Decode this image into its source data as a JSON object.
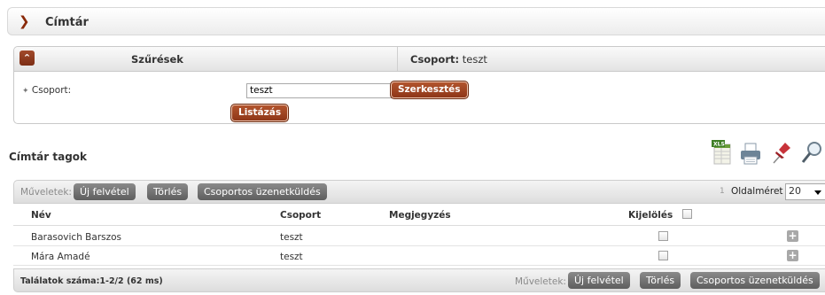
{
  "header": {
    "title": "Címtár"
  },
  "filters": {
    "toggle_label": "Szűrések",
    "group_summary_label": "Csoport:",
    "group_summary_value": "teszt",
    "group_field_label": "Csoport:",
    "group_value": "teszt",
    "edit_button": "Szerkesztés",
    "list_button": "Listázás"
  },
  "section": {
    "title": "Címtár tagok"
  },
  "icons": [
    "excel-export-icon",
    "print-icon",
    "pin-icon",
    "search-icon"
  ],
  "toolbar": {
    "ops_label": "Műveletek:",
    "new_button": "Új felvétel",
    "delete_button": "Törlés",
    "group_message_button": "Csoportos üzenetküldés",
    "page_number": "1",
    "page_size_label": "Oldalméret",
    "page_size_value": "20"
  },
  "table": {
    "columns": {
      "name": "Név",
      "group": "Csoport",
      "note": "Megjegyzés",
      "select": "Kijelölés"
    },
    "rows": [
      {
        "name": "Barasovich Barszos",
        "group": "teszt",
        "note": ""
      },
      {
        "name": "Mára Amadé",
        "group": "teszt",
        "note": ""
      }
    ]
  },
  "footer": {
    "count": "Találatok száma:1-2/2 (62 ms)",
    "ops_label": "Műveletek:",
    "new_button": "Új felvétel",
    "delete_button": "Törlés",
    "group_message_button": "Csoportos üzenetküldés"
  },
  "colors": {
    "accent_brown": "#8c3517",
    "button_grey": "#6e6e6e"
  }
}
